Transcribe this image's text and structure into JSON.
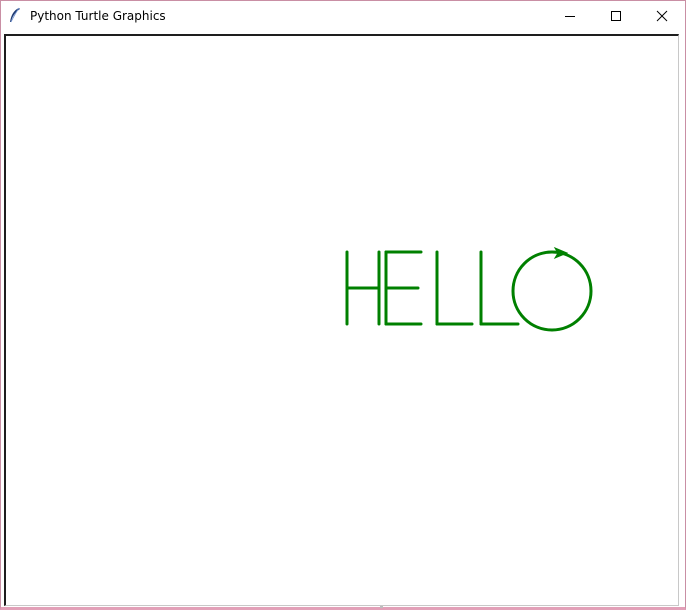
{
  "window": {
    "title": "Python Turtle Graphics",
    "app_icon": "feather-icon",
    "controls": {
      "minimize_icon": "minimize-icon",
      "maximize_icon": "maximize-icon",
      "close_icon": "close-icon"
    }
  },
  "canvas": {
    "background": "#ffffff",
    "drawing": {
      "text": "HELLO",
      "pen_color": "#008000",
      "turtle_icon": "turtle-arrow-icon"
    }
  }
}
